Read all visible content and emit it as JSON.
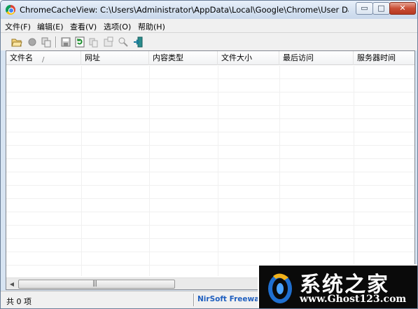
{
  "window": {
    "title": "ChromeCacheView:  C:\\Users\\Administrator\\AppData\\Local\\Google\\Chrome\\User Data\\De...",
    "minimize_glyph": "▭",
    "maximize_glyph": "□",
    "close_glyph": "✕"
  },
  "menu": {
    "items": [
      {
        "label": "文件(F)"
      },
      {
        "label": "编辑(E)"
      },
      {
        "label": "查看(V)"
      },
      {
        "label": "选项(O)"
      },
      {
        "label": "帮助(H)"
      }
    ]
  },
  "toolbar": {
    "buttons": [
      {
        "icon": "open-folder-icon"
      },
      {
        "icon": "stop-icon"
      },
      {
        "icon": "copy-files-icon"
      },
      {
        "icon": "save-icon"
      },
      {
        "icon": "refresh-icon"
      },
      {
        "icon": "copy-icon"
      },
      {
        "icon": "properties-icon"
      },
      {
        "icon": "find-icon"
      },
      {
        "icon": "exit-icon"
      }
    ]
  },
  "table": {
    "columns": [
      {
        "label": "文件名"
      },
      {
        "label": "网址"
      },
      {
        "label": "内容类型"
      },
      {
        "label": "文件大小"
      },
      {
        "label": "最后访问"
      },
      {
        "label": "服务器时间"
      }
    ],
    "sort_indicator": "/",
    "rows": []
  },
  "scrollbar": {
    "left_arrow": "◀",
    "right_arrow": "▶",
    "grip": "|||"
  },
  "status": {
    "count": "共 0 项",
    "link": "NirSoft Freeware."
  },
  "watermark": {
    "title": "系统之家",
    "url": "www.Ghost123.com"
  },
  "colors": {
    "title_bar": "#d3e0f0",
    "close_button": "#c94d35",
    "status_link": "#1f5fbf",
    "watermark_bg": "#0a0a0a"
  }
}
